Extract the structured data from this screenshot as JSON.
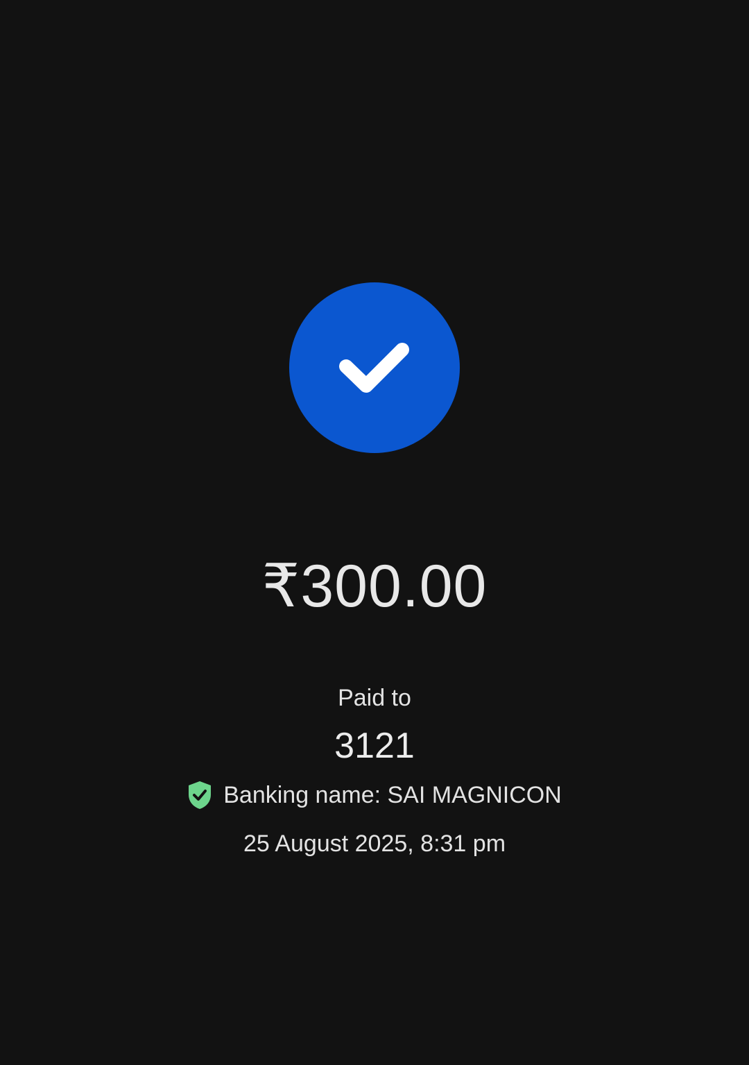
{
  "payment": {
    "amount": "₹300.00",
    "paid_to_label": "Paid to",
    "payee": "3121",
    "banking_label": "Banking name: ",
    "banking_name": "SAI MAGNICON",
    "timestamp": "25 August 2025, 8:31 pm"
  },
  "icons": {
    "status": "check-icon",
    "verified": "verified-shield-icon"
  },
  "colors": {
    "background": "#121212",
    "success_circle": "#0b57d0",
    "verified_shield": "#6dd58c",
    "text": "#e3e3e3"
  }
}
